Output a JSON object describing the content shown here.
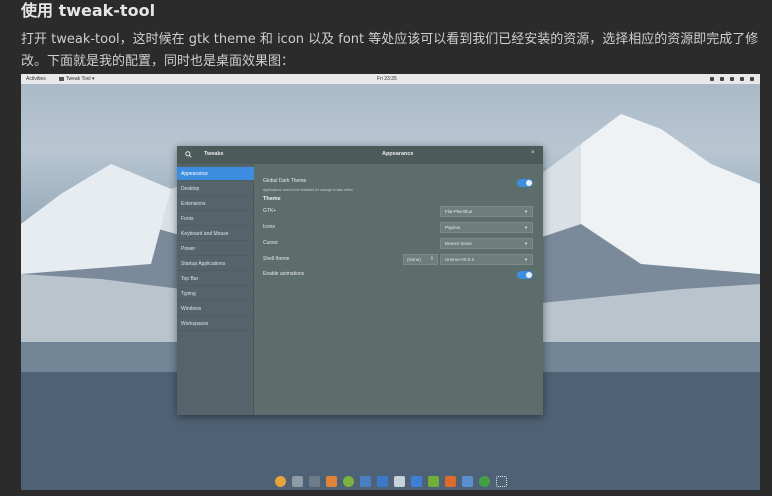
{
  "article": {
    "heading": "使用 tweak-tool",
    "paragraph": "打开 tweak-tool，这时候在 gtk theme 和 icon 以及 font 等处应该可以看到我们已经安装的资源，选择相应的资源即完成了修改。下面就是我的配置，同时也是桌面效果图："
  },
  "topbar": {
    "activities": "Activities",
    "app_menu": "Tweak Tool ▾",
    "clock": "Fri 23:35"
  },
  "window": {
    "sidebar_title": "Tweaks",
    "page_title": "Appearance",
    "close": "×",
    "sidebar": [
      {
        "label": "Appearance",
        "selected": true
      },
      {
        "label": "Desktop"
      },
      {
        "label": "Extensions"
      },
      {
        "label": "Fonts"
      },
      {
        "label": "Keyboard and Mouse"
      },
      {
        "label": "Power"
      },
      {
        "label": "Startup Applications"
      },
      {
        "label": "Top Bar"
      },
      {
        "label": "Typing"
      },
      {
        "label": "Windows"
      },
      {
        "label": "Workspaces"
      }
    ],
    "dark_theme_label": "Global Dark Theme",
    "dark_theme_hint": "Applications need to be restarted for change to take effect",
    "dark_theme_on": true,
    "theme_section": "Theme",
    "gtk_label": "GTK+",
    "gtk_value": "Flat-Plat-Blue",
    "icons_label": "Icons",
    "icons_value": "Papirus",
    "cursor_label": "Cursor",
    "cursor_value": "Breeze Snow",
    "shell_label": "Shell theme",
    "shell_none": "(None)",
    "shell_value": "Unerus-V0.0.2",
    "animations_label": "Enable animations",
    "animations_on": true
  },
  "colors": {
    "accent": "#3d8ee0"
  }
}
